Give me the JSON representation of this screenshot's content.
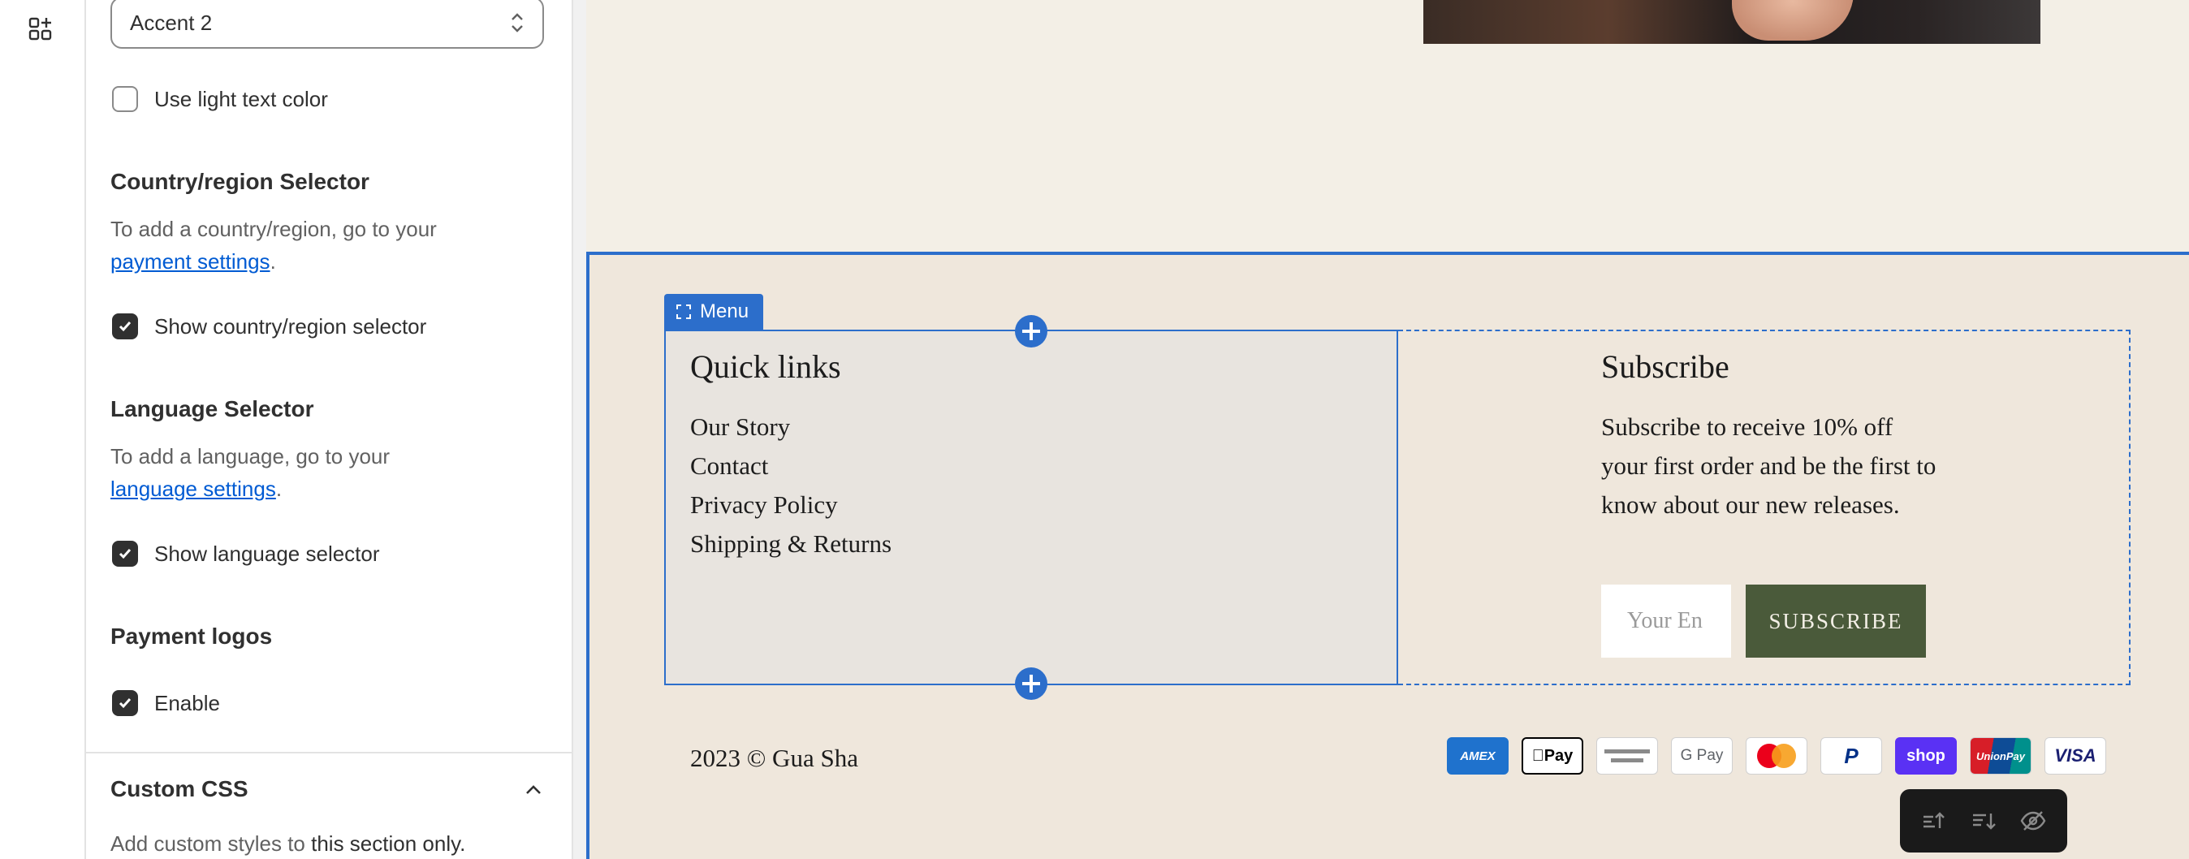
{
  "sidebar": {
    "color_scheme_value": "Accent 2",
    "light_text": {
      "label": "Use light text color",
      "checked": false
    },
    "country": {
      "heading": "Country/region Selector",
      "help_prefix": "To add a country/region, go to your",
      "help_link": "payment settings",
      "help_suffix": ".",
      "toggle_label": "Show country/region selector",
      "checked": true
    },
    "language": {
      "heading": "Language Selector",
      "help_prefix": "To add a language, go to your",
      "help_link": "language settings",
      "help_suffix": ".",
      "toggle_label": "Show language selector",
      "checked": true
    },
    "payment": {
      "heading": "Payment logos",
      "toggle_label": "Enable",
      "checked": true
    },
    "custom_css": {
      "heading": "Custom CSS",
      "help_prefix": "Add custom styles to",
      "help_bold": "this section only."
    }
  },
  "preview": {
    "menu_tag": "Menu",
    "quick_links": {
      "title": "Quick links",
      "items": [
        "Our Story",
        "Contact",
        "Privacy Policy",
        "Shipping & Returns"
      ]
    },
    "subscribe": {
      "title": "Subscribe",
      "text": "Subscribe to receive 10% off your first order and be the first to know about our new releases.",
      "email_placeholder": "Your En",
      "button": "SUBSCRIBE"
    },
    "copyright": "2023 © Gua Sha",
    "payment_icons": [
      {
        "name": "amex-icon",
        "label": "AMEX"
      },
      {
        "name": "apple-pay-icon",
        "label": "Pay"
      },
      {
        "name": "generic-card-icon",
        "label": ""
      },
      {
        "name": "google-pay-icon",
        "label": "G Pay"
      },
      {
        "name": "mastercard-icon",
        "label": ""
      },
      {
        "name": "paypal-icon",
        "label": "P"
      },
      {
        "name": "shop-pay-icon",
        "label": "shop"
      },
      {
        "name": "unionpay-icon",
        "label": "UnionPay"
      },
      {
        "name": "visa-icon",
        "label": "VISA"
      }
    ]
  },
  "colors": {
    "accent": "#2c6ecb",
    "footer_bg": "#efe7dc",
    "button_bg": "#4a5a3a",
    "link": "#005bd3"
  }
}
